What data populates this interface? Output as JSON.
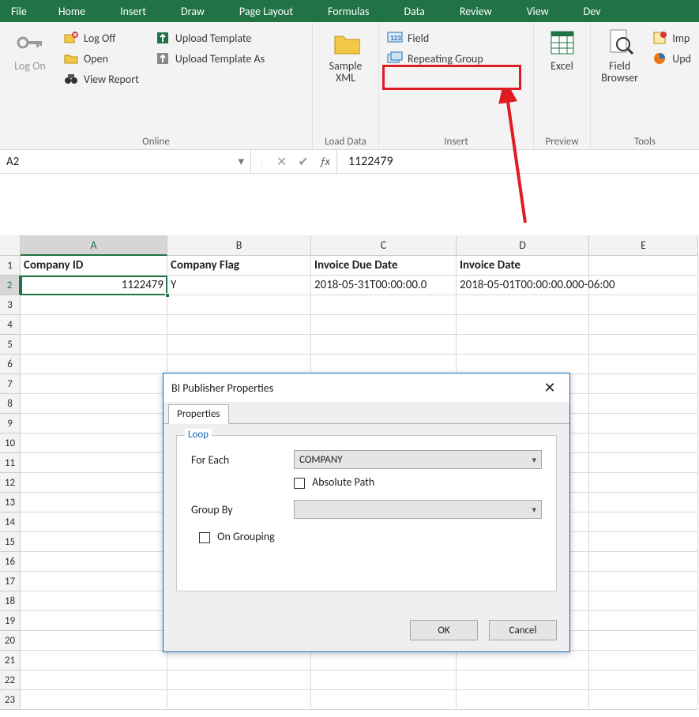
{
  "ribbon": {
    "tabs": [
      "File",
      "Home",
      "Insert",
      "Draw",
      "Page Layout",
      "Formulas",
      "Data",
      "Review",
      "View",
      "Dev"
    ],
    "logon_group": {
      "logon": "Log On",
      "logoff": "Log Off",
      "open": "Open",
      "view_report": "View Report",
      "upload_template": "Upload Template",
      "upload_template_as": "Upload Template As",
      "label": "Online"
    },
    "loaddata_group": {
      "sample_xml": "Sample XML",
      "label": "Load Data"
    },
    "insert_group": {
      "field": "Field",
      "repeating_group": "Repeating Group",
      "label": "Insert"
    },
    "preview_group": {
      "excel": "Excel",
      "label": "Preview"
    },
    "field_browser_group": {
      "field_browser": "Field Browser",
      "import": "Imp",
      "update": "Upd",
      "label": "Tools"
    }
  },
  "formula_bar": {
    "name": "A2",
    "value": "1122479"
  },
  "columns": [
    "A",
    "B",
    "C",
    "D",
    "E"
  ],
  "sheet": {
    "headers": [
      "Company ID",
      "Company Flag",
      "Invoice Due Date",
      "Invoice Date"
    ],
    "row2": {
      "A": "1122479",
      "B": "Y",
      "C": "2018-05-31T00:00:00.0",
      "D": "2018-05-01T00:00:00.000-06:00"
    }
  },
  "dialog": {
    "title": "BI Publisher Properties",
    "tab": "Properties",
    "legend": "Loop",
    "for_each_label": "For Each",
    "for_each_value": "COMPANY",
    "absolute_path": "Absolute Path",
    "group_by_label": "Group By",
    "group_by_value": "",
    "on_grouping": "On Grouping",
    "ok": "OK",
    "cancel": "Cancel"
  }
}
